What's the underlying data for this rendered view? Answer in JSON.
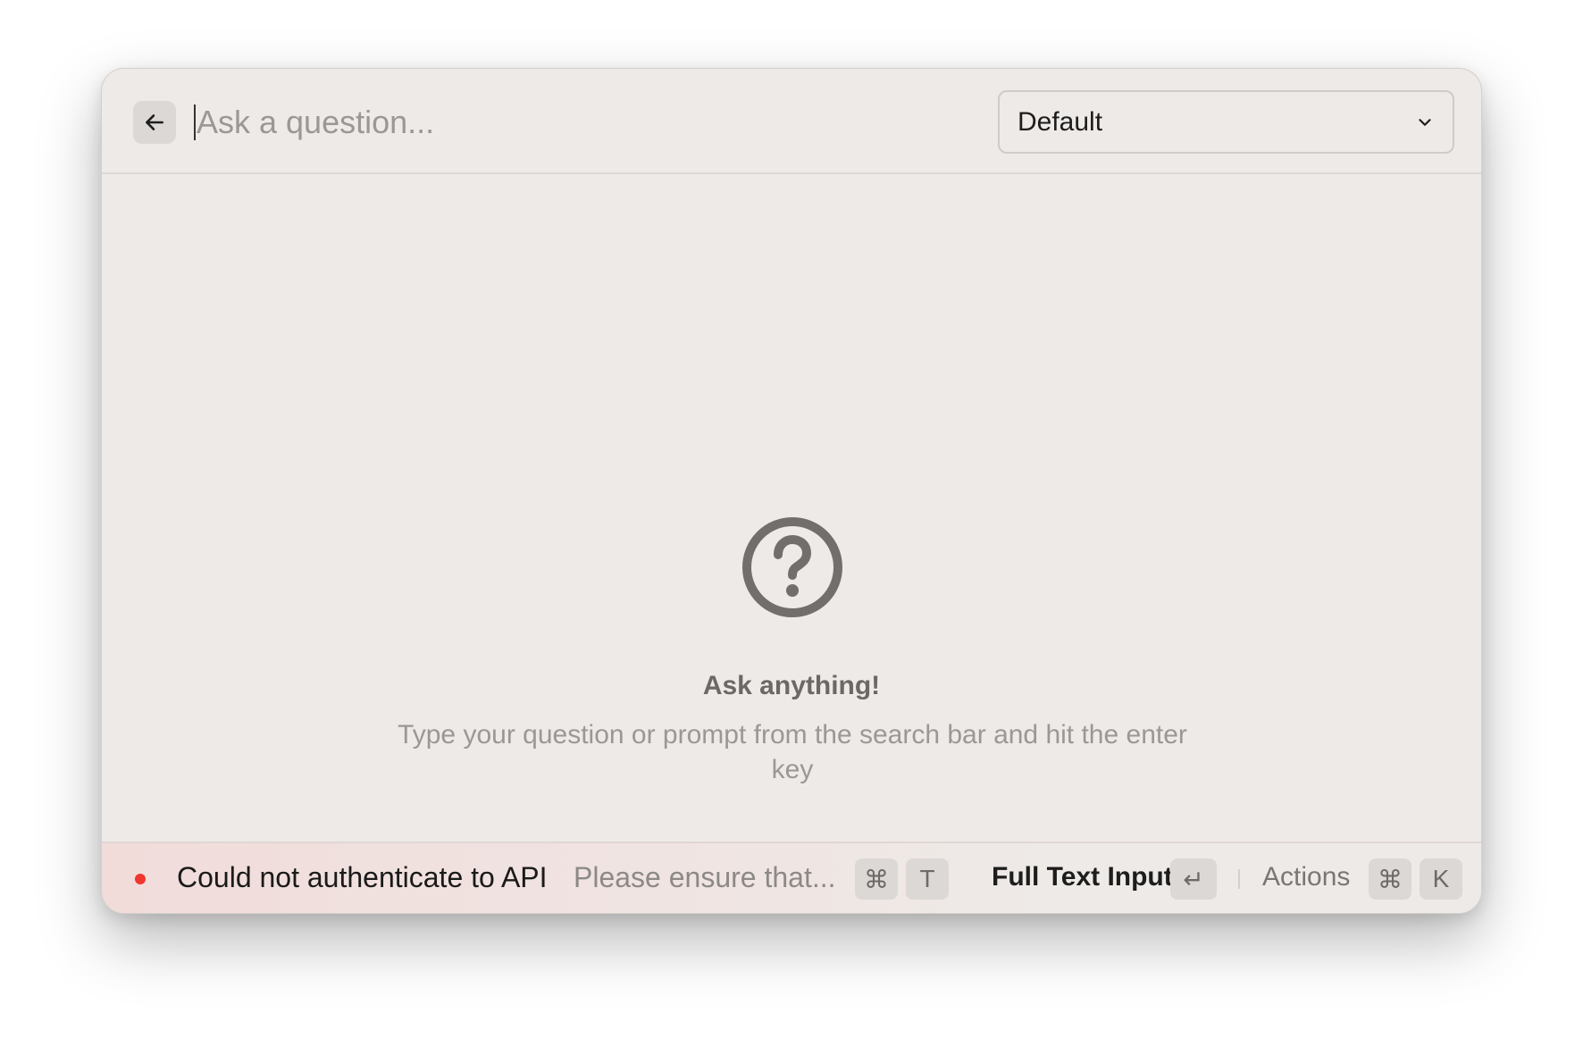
{
  "header": {
    "back_icon": "arrow-left-icon",
    "search_placeholder": "Ask a question...",
    "search_value": "",
    "model_dropdown": {
      "selected": "Default",
      "icon": "chevron-down-icon"
    }
  },
  "empty_state": {
    "icon": "question-circle-icon",
    "title": "Ask anything!",
    "description": "Type your question or prompt from the search bar and hit the enter key"
  },
  "footer": {
    "status_color": "#f0362f",
    "status_title": "Could not authenticate to API",
    "status_description": "Please ensure that...",
    "status_shortcut": [
      "⌘",
      "T"
    ],
    "primary_action": "Full Text Input",
    "primary_action_key": "↵",
    "actions_label": "Actions",
    "actions_shortcut": [
      "⌘",
      "K"
    ]
  }
}
